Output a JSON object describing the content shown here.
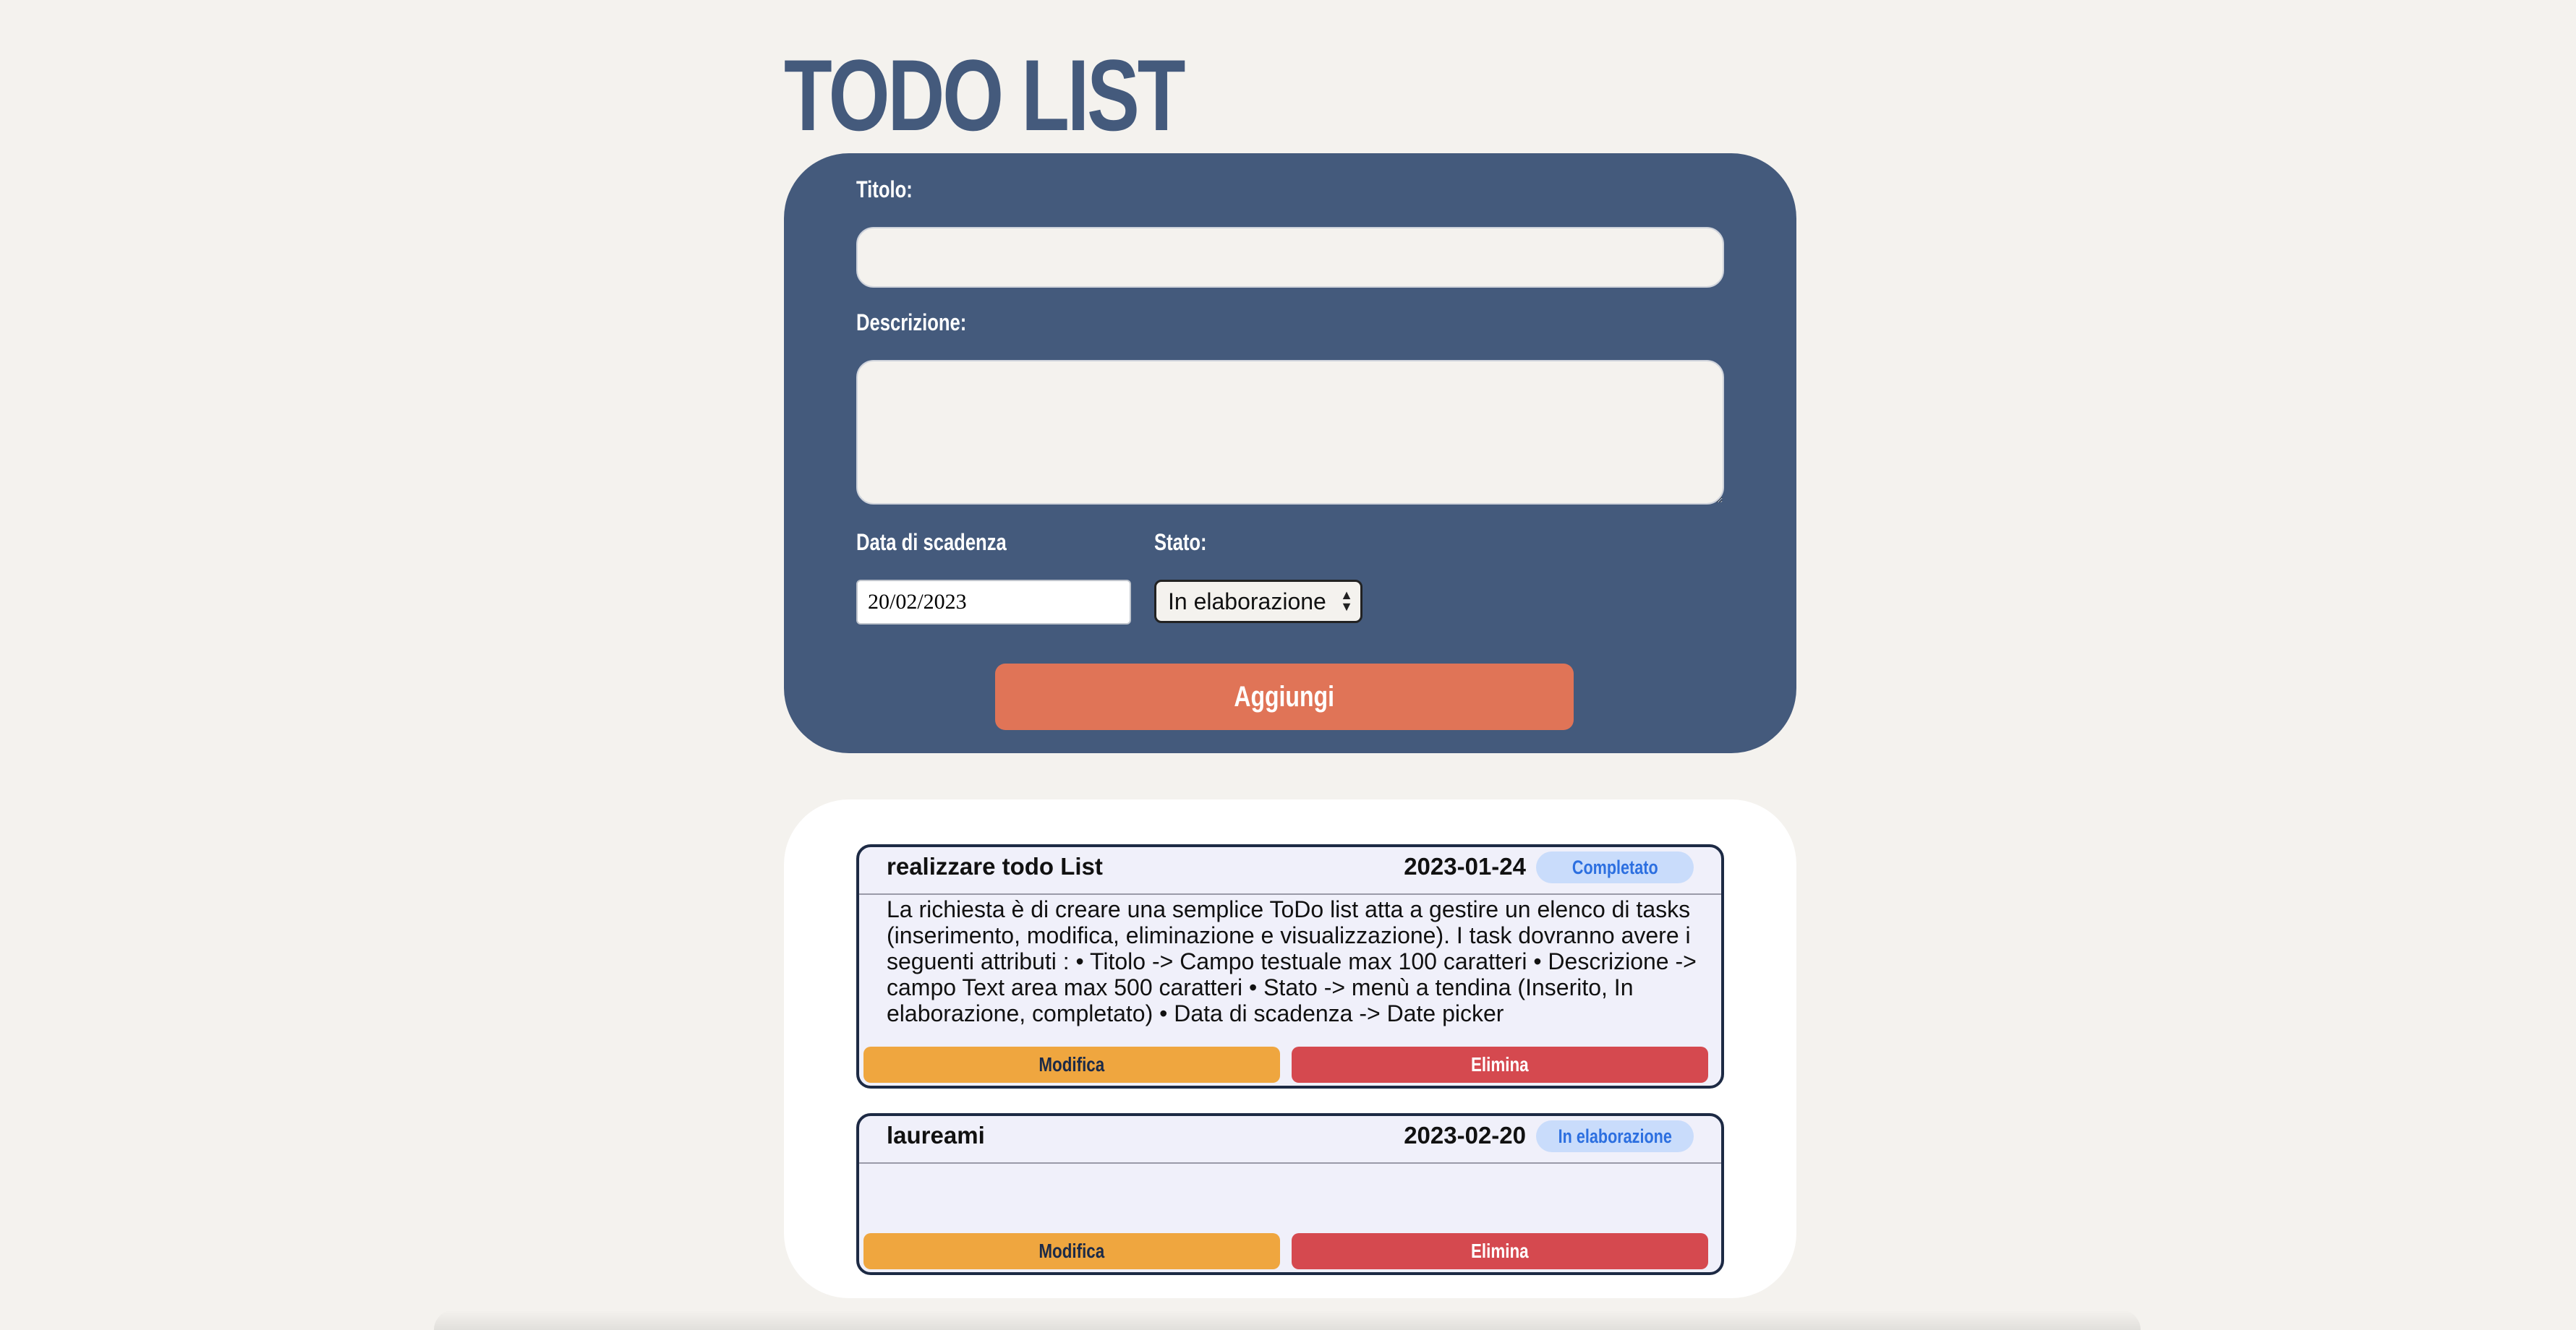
{
  "app": {
    "title": "TODO LIST"
  },
  "form": {
    "title_label": "Titolo:",
    "title_value": "",
    "description_label": "Descrizione:",
    "description_value": "",
    "due_date_label": "Data di scadenza",
    "due_date_value": "20/02/2023",
    "status_label": "Stato:",
    "status_value": "In elaborazione",
    "add_button_label": "Aggiungi"
  },
  "todos": [
    {
      "title": "realizzare todo List",
      "date": "2023-01-24",
      "status": "Completato",
      "description": "La richiesta è di creare una semplice ToDo list atta a gestire un elenco di tasks (inserimento, modifica, eliminazione e visualizzazione). I task dovranno avere i seguenti attributi : • Titolo -> Campo testuale max 100 caratteri • Descrizione -> campo Text area max 500 caratteri • Stato -> menù a tendina (Inserito, In elaborazione, completato) • Data di scadenza -> Date picker",
      "edit_label": "Modifica",
      "delete_label": "Elimina"
    },
    {
      "title": "laureami",
      "date": "2023-02-20",
      "status": "In elaborazione",
      "description": "",
      "edit_label": "Modifica",
      "delete_label": "Elimina"
    }
  ],
  "colors": {
    "background": "#f4f2ee",
    "panel": "#445a7c",
    "accent": "#e07457",
    "edit": "#efa63f",
    "delete": "#d5494f",
    "badge_bg": "#c9dcfb",
    "badge_text": "#2c6fe0"
  },
  "icons": {
    "select_arrows": "up-down-arrows-icon"
  }
}
